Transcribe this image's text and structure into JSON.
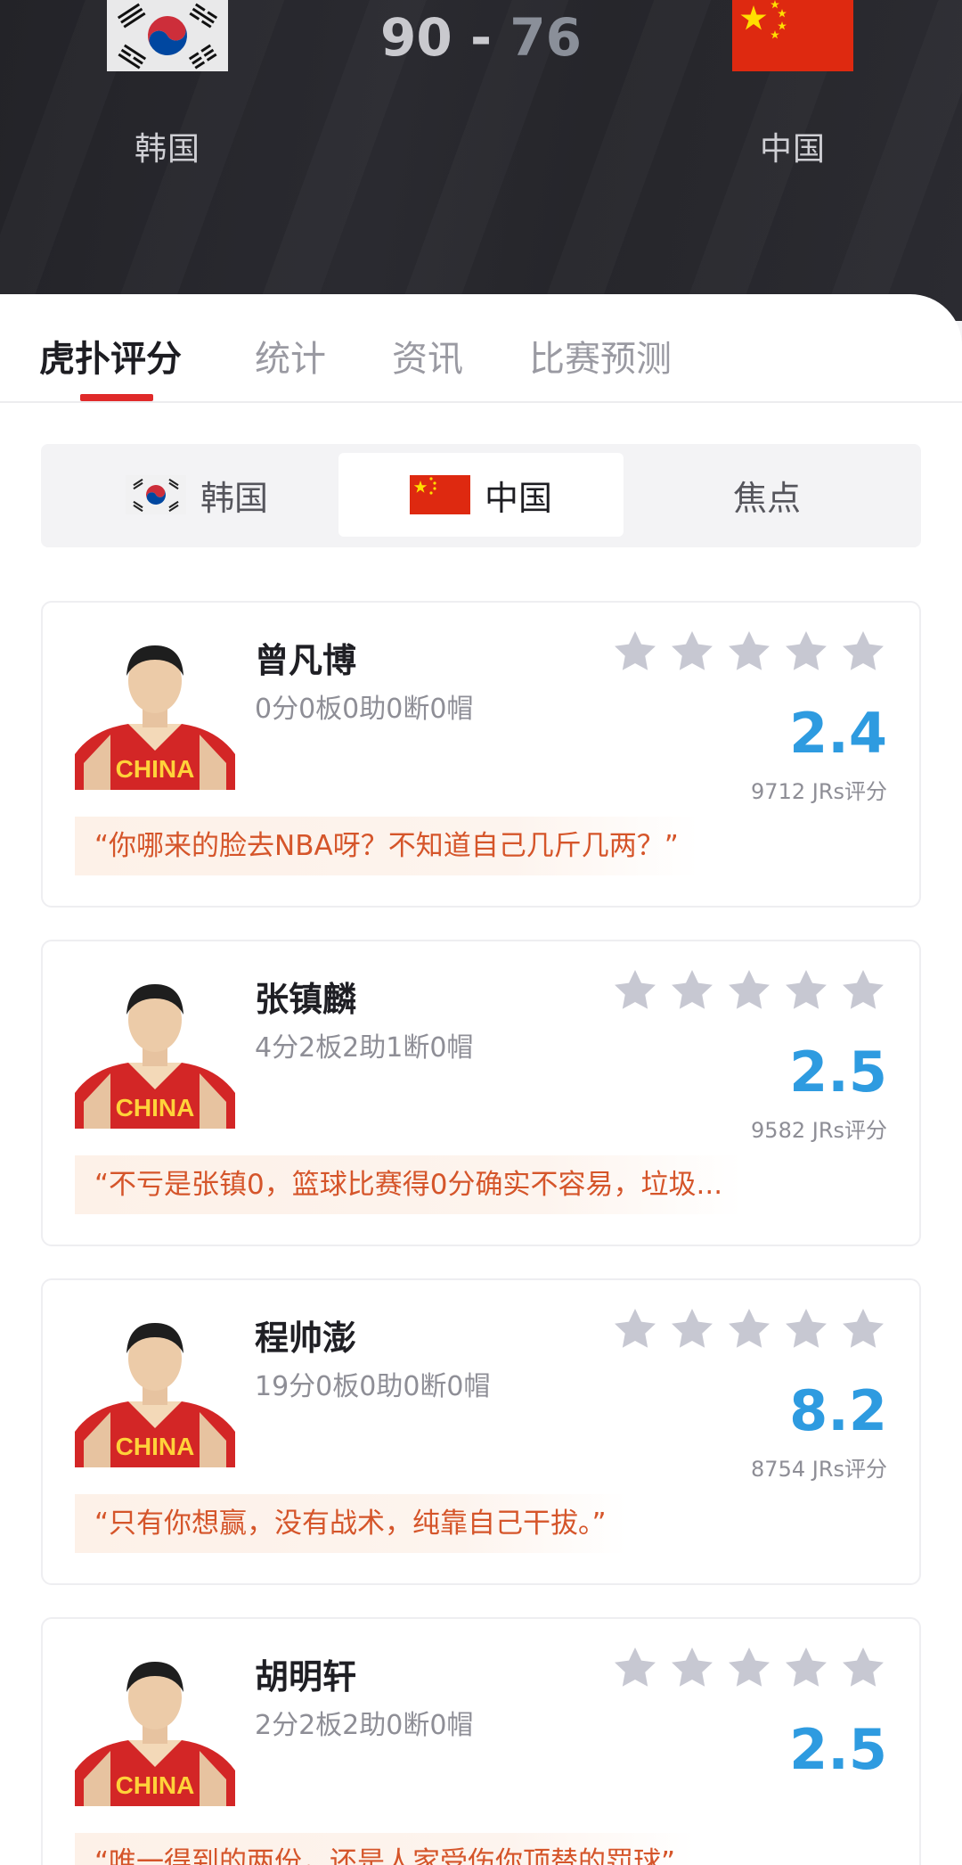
{
  "match": {
    "home_team": "韩国",
    "away_team": "中国",
    "home_score": "90",
    "score_separator": "-",
    "away_score": "76"
  },
  "tabs": [
    {
      "label": "虎扑评分",
      "active": true
    },
    {
      "label": "统计",
      "active": false
    },
    {
      "label": "资讯",
      "active": false
    },
    {
      "label": "比赛预测",
      "active": false
    }
  ],
  "segments": [
    {
      "label": "韩国",
      "flag": "korea-flag-icon",
      "active": false
    },
    {
      "label": "中国",
      "flag": "china-flag-icon",
      "active": true
    },
    {
      "label": "焦点",
      "active": false
    }
  ],
  "players": [
    {
      "name": "曾凡博",
      "stats": "0分0板0助0断0帽",
      "stars": 5,
      "rating": "2.4",
      "votes": "9712 JRs评分",
      "comment": "“你哪来的脸去NBA呀？不知道自己几斤几两？”"
    },
    {
      "name": "张镇麟",
      "stats": "4分2板2助1断0帽",
      "stars": 5,
      "rating": "2.5",
      "votes": "9582 JRs评分",
      "comment": "“不亏是张镇0，篮球比赛得0分确实不容易，垃圾..."
    },
    {
      "name": "程帅澎",
      "stats": "19分0板0助0断0帽",
      "stars": 5,
      "rating": "8.2",
      "votes": "8754 JRs评分",
      "comment": "“只有你想赢，没有战术，纯靠自己干拔。”"
    },
    {
      "name": "胡明轩",
      "stats": "2分2板2助0断0帽",
      "stars": 5,
      "rating": "2.5",
      "votes": "",
      "comment": "“唯一得到的两份，还是人家受伤你顶替的罚球”"
    }
  ],
  "colors": {
    "accent_red": "#e02a2a",
    "rating_blue": "#2e9be0",
    "comment_orange": "#d5552a",
    "star_gray": "#c7c8d2"
  }
}
